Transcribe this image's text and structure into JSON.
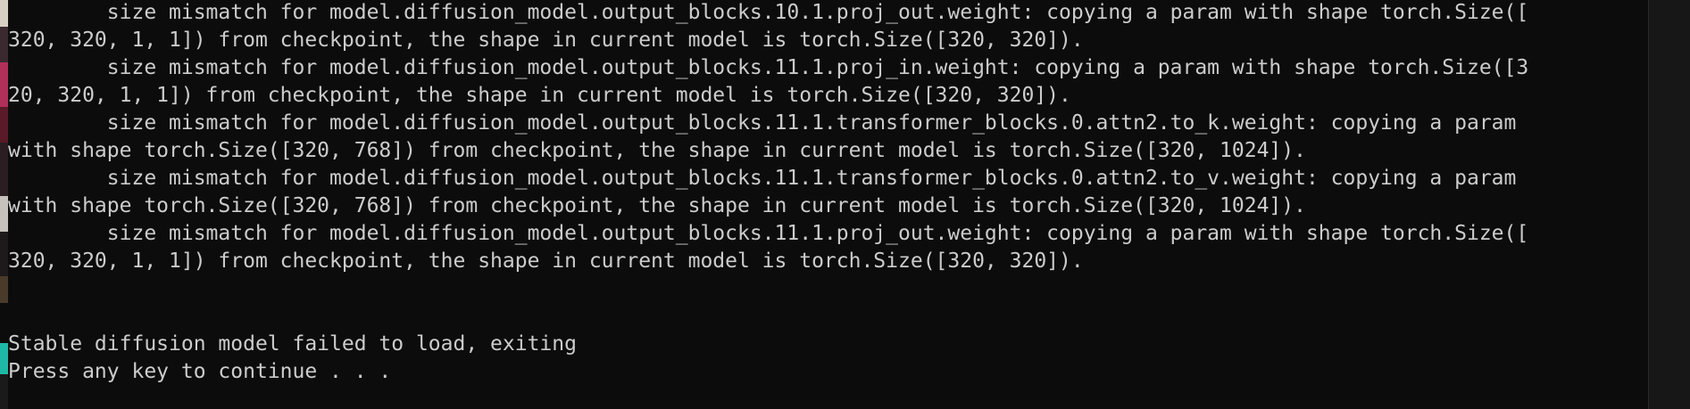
{
  "terminal": {
    "lines": [
      "        size mismatch for model.diffusion_model.output_blocks.10.1.proj_out.weight: copying a param with shape torch.Size([",
      "320, 320, 1, 1]) from checkpoint, the shape in current model is torch.Size([320, 320]).",
      "        size mismatch for model.diffusion_model.output_blocks.11.1.proj_in.weight: copying a param with shape torch.Size([3",
      "20, 320, 1, 1]) from checkpoint, the shape in current model is torch.Size([320, 320]).",
      "        size mismatch for model.diffusion_model.output_blocks.11.1.transformer_blocks.0.attn2.to_k.weight: copying a param",
      "with shape torch.Size([320, 768]) from checkpoint, the shape in current model is torch.Size([320, 1024]).",
      "        size mismatch for model.diffusion_model.output_blocks.11.1.transformer_blocks.0.attn2.to_v.weight: copying a param",
      "with shape torch.Size([320, 768]) from checkpoint, the shape in current model is torch.Size([320, 1024]).",
      "        size mismatch for model.diffusion_model.output_blocks.11.1.proj_out.weight: copying a param with shape torch.Size([",
      "320, 320, 1, 1]) from checkpoint, the shape in current model is torch.Size([320, 320]).",
      "",
      "",
      "Stable diffusion model failed to load, exiting",
      "Press any key to continue . . ."
    ]
  },
  "colors": {
    "background": "#0c0c0c",
    "text": "#cccccc",
    "scrollbar": "#171717"
  }
}
